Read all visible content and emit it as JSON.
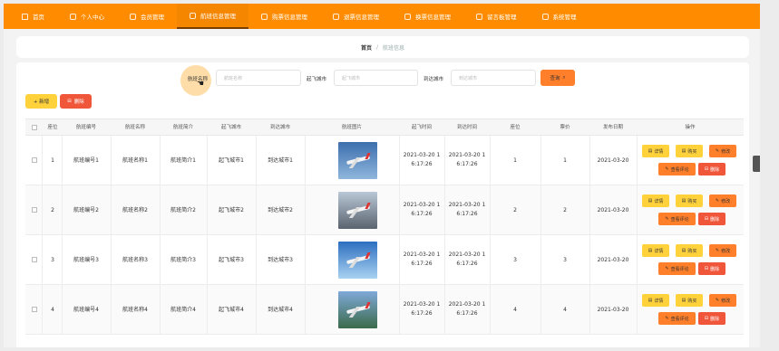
{
  "nav": [
    {
      "label": "首页",
      "icon": "home-icon"
    },
    {
      "label": "个人中心",
      "icon": "user-icon"
    },
    {
      "label": "会员管理",
      "icon": "members-icon"
    },
    {
      "label": "航班信息管理",
      "icon": "flight-icon"
    },
    {
      "label": "购票信息管理",
      "icon": "ticket-icon"
    },
    {
      "label": "退票信息管理",
      "icon": "refund-icon"
    },
    {
      "label": "换票信息管理",
      "icon": "exchange-icon"
    },
    {
      "label": "留言板管理",
      "icon": "message-icon"
    },
    {
      "label": "系统管理",
      "icon": "system-icon"
    }
  ],
  "breadcrumb": {
    "home": "首页",
    "separator": "/",
    "current": "航班信息"
  },
  "search": {
    "flight_name_label": "航班名称",
    "flight_name_placeholder": "航班名称",
    "departure_label": "起飞城市",
    "departure_placeholder": "起飞城市",
    "arrival_label": "到达城市",
    "arrival_placeholder": "到达城市",
    "query_label": "查询"
  },
  "toolbar": {
    "add_label": "+ 新增",
    "delete_label": "删除"
  },
  "table": {
    "headers": [
      "座位",
      "航班编号",
      "航班名称",
      "航班简介",
      "起飞城市",
      "到达城市",
      "航班图片",
      "起飞时间",
      "到达时间",
      "座位",
      "票价",
      "发布日期",
      "操作"
    ],
    "rows": [
      {
        "index": "1",
        "number": "航班编号1",
        "name": "航班名称1",
        "intro": "航班简介1",
        "from": "起飞城市1",
        "to": "到达城市1",
        "dep_time": "2021-03-20 1\n6:17:26",
        "arr_time": "2021-03-20 1\n6:17:26",
        "seats": "1",
        "price": "1",
        "date": "2021-03-20"
      },
      {
        "index": "2",
        "number": "航班编号2",
        "name": "航班名称2",
        "intro": "航班简介2",
        "from": "起飞城市2",
        "to": "到达城市2",
        "dep_time": "2021-03-20 1\n6:17:26",
        "arr_time": "2021-03-20 1\n6:17:26",
        "seats": "2",
        "price": "2",
        "date": "2021-03-20"
      },
      {
        "index": "3",
        "number": "航班编号3",
        "name": "航班名称3",
        "intro": "航班简介3",
        "from": "起飞城市3",
        "to": "到达城市3",
        "dep_time": "2021-03-20 1\n6:17:26",
        "arr_time": "2021-03-20 1\n6:17:26",
        "seats": "3",
        "price": "3",
        "date": "2021-03-20"
      },
      {
        "index": "4",
        "number": "航班编号4",
        "name": "航班名称4",
        "intro": "航班简介4",
        "from": "起飞城市4",
        "to": "到达城市4",
        "dep_time": "2021-03-20 1\n6:17:26",
        "arr_time": "2021-03-20 1\n6:17:26",
        "seats": "4",
        "price": "4",
        "date": "2021-03-20"
      }
    ],
    "actions": {
      "detail": "详情",
      "buy": "购买",
      "edit": "修改",
      "review": "查看评论",
      "delete": "删除"
    }
  },
  "colors": {
    "accent": "#ff8c00",
    "add": "#ffd23c",
    "delete": "#f0563a",
    "action_orange": "#ff7f2a"
  }
}
